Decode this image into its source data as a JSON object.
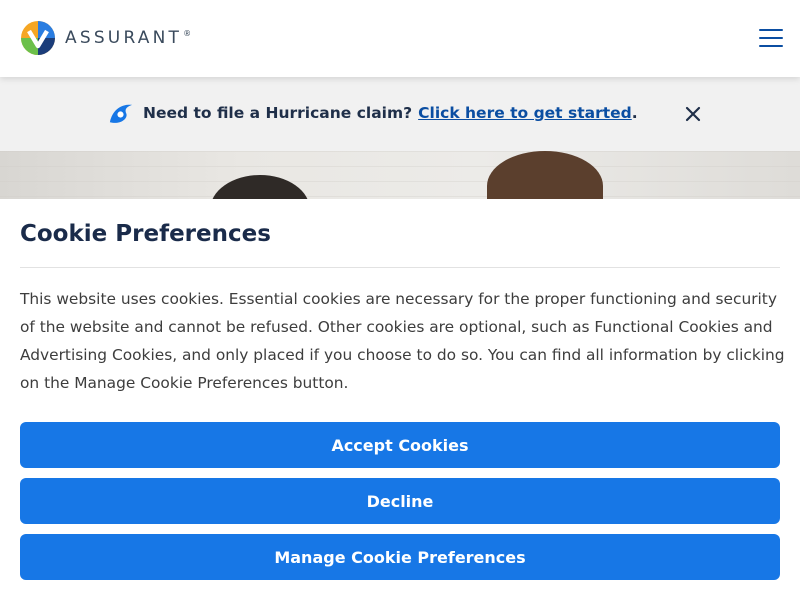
{
  "header": {
    "brand": "ASSURANT",
    "registered_mark": "®",
    "logo_icon": "assurant-logo-icon",
    "menu_icon": "hamburger-menu-icon"
  },
  "banner": {
    "icon": "hurricane-icon",
    "question": "Need to file a Hurricane claim?",
    "link": "Click here to get started",
    "punctuation": ".",
    "close_icon": "close-icon"
  },
  "cookie": {
    "title": "Cookie Preferences",
    "body": "This website uses cookies. Essential cookies are necessary for the proper functioning and security of the website and cannot be refused. Other cookies are optional, such as Functional Cookies and Advertising Cookies, and only placed if you choose to do so. You can find all information by clicking on the Manage Cookie Preferences button.",
    "accept_label": "Accept Cookies",
    "decline_label": "Decline",
    "manage_label": "Manage Cookie Preferences"
  },
  "colors": {
    "primary_button": "#1777e6",
    "link": "#0b4ea2",
    "heading": "#1a2b4a",
    "banner_bg": "#f1f1f1"
  }
}
